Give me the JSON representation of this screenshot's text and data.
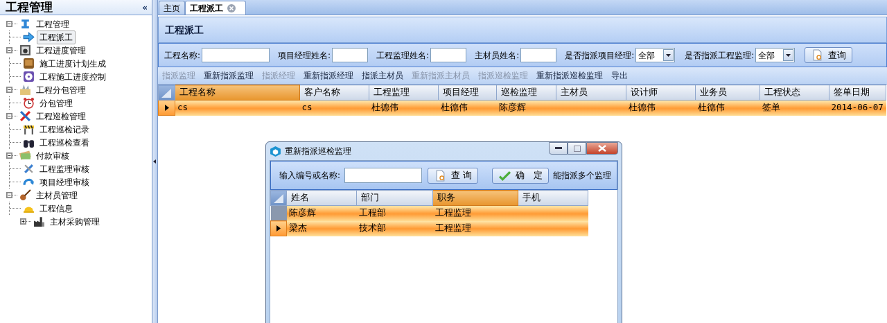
{
  "sidebar": {
    "title": "工程管理",
    "collapse": "«",
    "tree": [
      {
        "label": "工程管理",
        "expanded": true,
        "selected": false,
        "children": [
          {
            "label": "工程派工",
            "selected": true
          }
        ]
      },
      {
        "label": "工程进度管理",
        "expanded": true,
        "selected": false,
        "children": [
          {
            "label": "施工进度计划生成",
            "selected": false
          },
          {
            "label": "工程施工进度控制",
            "selected": false
          }
        ]
      },
      {
        "label": "工程分包管理",
        "expanded": true,
        "selected": false,
        "children": [
          {
            "label": "分包管理",
            "selected": false
          }
        ]
      },
      {
        "label": "工程巡检管理",
        "expanded": true,
        "selected": false,
        "children": [
          {
            "label": "工程巡检记录",
            "selected": false
          },
          {
            "label": "工程巡检查看",
            "selected": false
          }
        ]
      },
      {
        "label": "付款审核",
        "expanded": true,
        "selected": false,
        "children": [
          {
            "label": "工程监理审核",
            "selected": false
          },
          {
            "label": "项目经理审核",
            "selected": false
          }
        ]
      },
      {
        "label": "主材员管理",
        "expanded": true,
        "selected": false,
        "children": [
          {
            "label": "工程信息",
            "selected": false
          },
          {
            "label": "主材采购管理",
            "selected": false,
            "expanded": false
          }
        ]
      }
    ]
  },
  "tabs": [
    {
      "label": "主页",
      "selected": false,
      "closable": false
    },
    {
      "label": "工程派工",
      "selected": true,
      "closable": true
    }
  ],
  "panel_title": "工程派工",
  "filters": [
    {
      "kind": "text",
      "label": "工程名称:"
    },
    {
      "kind": "text",
      "label": "项目经理姓名:"
    },
    {
      "kind": "text",
      "label": "工程监理姓名:"
    },
    {
      "kind": "text",
      "label": "主材员姓名:"
    },
    {
      "kind": "select",
      "label": "是否指派项目经理:",
      "value": "全部"
    },
    {
      "kind": "select",
      "label": "是否指派工程监理:",
      "value": "全部"
    }
  ],
  "search_button": "查询",
  "toolbar": [
    {
      "label": "指派监理",
      "disabled": true
    },
    {
      "label": "重新指派监理",
      "disabled": false
    },
    {
      "label": "指派经理",
      "disabled": true
    },
    {
      "label": "重新指派经理",
      "disabled": false
    },
    {
      "label": "指派主材员",
      "disabled": false
    },
    {
      "label": "重新指派主材员",
      "disabled": true
    },
    {
      "label": "指派巡检监理",
      "disabled": true
    },
    {
      "label": "重新指派巡检监理",
      "disabled": false
    },
    {
      "label": "导出",
      "disabled": false
    }
  ],
  "table": {
    "columns": [
      {
        "label": "工程名称",
        "highlighted": true
      },
      {
        "label": "客户名称",
        "highlighted": false
      },
      {
        "label": "工程监理",
        "highlighted": false
      },
      {
        "label": "项目经理",
        "highlighted": false
      },
      {
        "label": "巡检监理",
        "highlighted": false
      },
      {
        "label": "主材员",
        "highlighted": false
      },
      {
        "label": "设计师",
        "highlighted": false
      },
      {
        "label": "业务员",
        "highlighted": false
      },
      {
        "label": "工程状态",
        "highlighted": false
      },
      {
        "label": "签单日期",
        "highlighted": false
      }
    ],
    "rows": [
      {
        "selected": true,
        "current": true,
        "cells": [
          "cs",
          "cs",
          "杜德伟",
          "杜德伟",
          "陈彦辉",
          "",
          "杜德伟",
          "杜德伟",
          "签单",
          "2014-06-07"
        ]
      }
    ]
  },
  "dialog": {
    "title": "重新指派巡检监理",
    "search_label": "输入编号或名称:",
    "search_button": "查 询",
    "confirm_button": "确　定",
    "note": "能指派多个监理",
    "columns": [
      {
        "label": "姓名",
        "highlighted": false
      },
      {
        "label": "部门",
        "highlighted": false
      },
      {
        "label": "职务",
        "highlighted": true
      },
      {
        "label": "手机",
        "highlighted": false
      }
    ],
    "rows": [
      {
        "selected": true,
        "current": false,
        "cells": [
          "陈彦辉",
          "工程部",
          "工程监理",
          ""
        ]
      },
      {
        "selected": true,
        "current": true,
        "cells": [
          "梁杰",
          "技术部",
          "工程监理",
          ""
        ]
      }
    ]
  }
}
